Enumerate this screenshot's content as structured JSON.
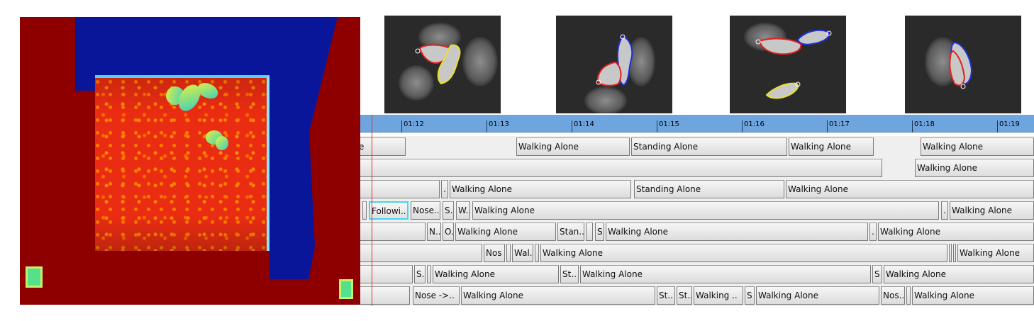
{
  "timeline": {
    "ticks": [
      "01:12",
      "01:13",
      "01:14",
      "01:15",
      "01:16",
      "01:17",
      "01:18",
      "01:19"
    ],
    "tracks": [
      {
        "segments": [
          {
            "label": "one",
            "sel": false
          },
          {
            "label": "Walking Alone",
            "sel": false
          },
          {
            "label": "Standing Alone",
            "sel": false
          },
          {
            "label": "Walking Alone",
            "sel": false
          },
          {
            "label": "Walking Alone",
            "sel": false
          }
        ]
      },
      {
        "segments": [
          {
            "label": "",
            "sel": false
          },
          {
            "label": "Walking Alone",
            "sel": false
          }
        ]
      },
      {
        "segments": [
          {
            "label": "",
            "sel": false
          },
          {
            "label": ".",
            "sel": false
          },
          {
            "label": "Walking Alone",
            "sel": false
          },
          {
            "label": "Standing Alone",
            "sel": false
          },
          {
            "label": "Walking Alone",
            "sel": false
          }
        ]
      },
      {
        "segments": [
          {
            "label": "",
            "sel": false
          },
          {
            "label": "Followi..",
            "sel": true
          },
          {
            "label": "Nose..",
            "sel": false
          },
          {
            "label": "S..",
            "sel": false
          },
          {
            "label": "W..",
            "sel": false
          },
          {
            "label": "Walking Alone",
            "sel": false
          },
          {
            "label": ".",
            "sel": false
          },
          {
            "label": "Walking Alone",
            "sel": false
          }
        ]
      },
      {
        "segments": [
          {
            "label": "",
            "sel": false
          },
          {
            "label": "N..",
            "sel": false
          },
          {
            "label": "O..",
            "sel": false
          },
          {
            "label": "Walking Alone",
            "sel": false
          },
          {
            "label": "Stan..",
            "sel": false
          },
          {
            "label": "",
            "sel": false
          },
          {
            "label": "S",
            "sel": false
          },
          {
            "label": "Walking Alone",
            "sel": false
          },
          {
            "label": ".",
            "sel": false
          },
          {
            "label": "Walking Alone",
            "sel": false
          }
        ]
      },
      {
        "segments": [
          {
            "label": "",
            "sel": false
          },
          {
            "label": "Nos",
            "sel": false
          },
          {
            "label": "",
            "sel": false
          },
          {
            "label": "Wal..",
            "sel": false
          },
          {
            "label": "",
            "sel": false
          },
          {
            "label": "Walking Alone",
            "sel": false
          },
          {
            "label": "",
            "sel": false
          },
          {
            "label": "",
            "sel": false
          },
          {
            "label": "Walking Alone",
            "sel": false
          }
        ]
      },
      {
        "segments": [
          {
            "label": "",
            "sel": false
          },
          {
            "label": "S..",
            "sel": false
          },
          {
            "label": "",
            "sel": false
          },
          {
            "label": "Walking Alone",
            "sel": false
          },
          {
            "label": "St..",
            "sel": false
          },
          {
            "label": "Walking Alone",
            "sel": false
          },
          {
            "label": "S",
            "sel": false
          },
          {
            "label": "Walking Alone",
            "sel": false
          }
        ]
      },
      {
        "segments": [
          {
            "label": "",
            "sel": false
          },
          {
            "label": "Nose ->..",
            "sel": false
          },
          {
            "label": "Walking Alone",
            "sel": false
          },
          {
            "label": "St..",
            "sel": false
          },
          {
            "label": "St..",
            "sel": false
          },
          {
            "label": "Walking ..",
            "sel": false
          },
          {
            "label": "S",
            "sel": false
          },
          {
            "label": "Walking Alone",
            "sel": false
          },
          {
            "label": "Nos..",
            "sel": false
          },
          {
            "label": "",
            "sel": false
          },
          {
            "label": "Walking Alone",
            "sel": false
          }
        ]
      }
    ]
  },
  "colors": {
    "ruler": "#6ea5de",
    "cursor": "#e0302a",
    "selection": "#3fd7ef",
    "contour_red": "#e0201c",
    "contour_yellow": "#e8e22a",
    "contour_blue": "#2030d8"
  }
}
